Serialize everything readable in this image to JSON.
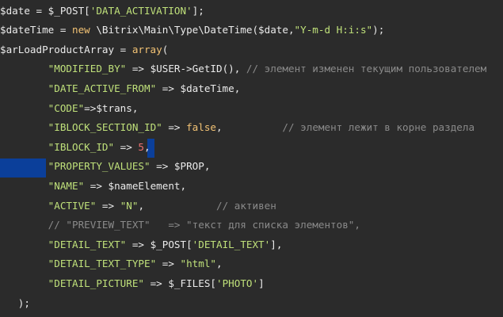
{
  "editor": {
    "colors": {
      "background": "#2b2b2b",
      "selection": "#0b3f9a",
      "string": "#bfe07a",
      "keyword": "#f2c274",
      "number": "#f27272",
      "comment": "#8a8a8a"
    },
    "lines": [
      {
        "tokens": [
          {
            "t": "$date = $_POST[",
            "c": "var"
          },
          {
            "t": "'DATA_ACTIVATION'",
            "c": "str"
          },
          {
            "t": "];",
            "c": "op"
          }
        ]
      },
      {
        "tokens": [
          {
            "t": "$dateTime = ",
            "c": "var"
          },
          {
            "t": "new",
            "c": "kw"
          },
          {
            "t": " \\Bitrix\\Main\\Type\\DateTime($date,",
            "c": "plain"
          },
          {
            "t": "\"Y-m-d H:i:s\"",
            "c": "str"
          },
          {
            "t": ");",
            "c": "op"
          }
        ]
      },
      {
        "tokens": [
          {
            "t": "$arLoadProductArray = ",
            "c": "var"
          },
          {
            "t": "array",
            "c": "kw"
          },
          {
            "t": "(",
            "c": "op"
          }
        ]
      },
      {
        "tokens": [
          {
            "t": "        ",
            "c": "plain"
          },
          {
            "t": "\"MODIFIED_BY\"",
            "c": "str"
          },
          {
            "t": " => $USER->GetID(), ",
            "c": "plain"
          },
          {
            "t": "// элемент изменен текущим пользователем",
            "c": "cm"
          }
        ]
      },
      {
        "tokens": [
          {
            "t": "        ",
            "c": "plain"
          },
          {
            "t": "\"DATE_ACTIVE_FROM\"",
            "c": "str"
          },
          {
            "t": " => $dateTime,",
            "c": "plain"
          }
        ]
      },
      {
        "tokens": [
          {
            "t": "        ",
            "c": "plain"
          },
          {
            "t": "\"CODE\"",
            "c": "str"
          },
          {
            "t": "=>$trans,",
            "c": "plain"
          }
        ]
      },
      {
        "tokens": [
          {
            "t": "        ",
            "c": "plain"
          },
          {
            "t": "\"IBLOCK_SECTION_ID\"",
            "c": "str"
          },
          {
            "t": " => ",
            "c": "plain"
          },
          {
            "t": "false",
            "c": "kw"
          },
          {
            "t": ",          ",
            "c": "plain"
          },
          {
            "t": "// элемент лежит в корне раздела",
            "c": "cm"
          }
        ]
      },
      {
        "tokens": [
          {
            "t": "        ",
            "c": "plain"
          },
          {
            "t": "\"IBLOCK_ID\"",
            "c": "str"
          },
          {
            "t": " => ",
            "c": "plain"
          },
          {
            "t": "5",
            "c": "num"
          },
          {
            "t": ",",
            "c": "plain"
          }
        ]
      },
      {
        "tokens": [
          {
            "t": "        ",
            "c": "plain"
          },
          {
            "t": "\"PROPERTY_VALUES\"",
            "c": "str"
          },
          {
            "t": " => $PROP,",
            "c": "plain"
          }
        ]
      },
      {
        "tokens": [
          {
            "t": "        ",
            "c": "plain"
          },
          {
            "t": "\"NAME\"",
            "c": "str"
          },
          {
            "t": " => $nameElement,",
            "c": "plain"
          }
        ]
      },
      {
        "tokens": [
          {
            "t": "        ",
            "c": "plain"
          },
          {
            "t": "\"ACTIVE\"",
            "c": "str"
          },
          {
            "t": " => ",
            "c": "plain"
          },
          {
            "t": "\"N\"",
            "c": "str"
          },
          {
            "t": ",            ",
            "c": "plain"
          },
          {
            "t": "// активен",
            "c": "cm"
          }
        ]
      },
      {
        "tokens": [
          {
            "t": "        ",
            "c": "plain"
          },
          {
            "t": "// \"PREVIEW_TEXT\"   => \"текст для списка элементов\",",
            "c": "cm"
          }
        ]
      },
      {
        "tokens": [
          {
            "t": "        ",
            "c": "plain"
          },
          {
            "t": "\"DETAIL_TEXT\"",
            "c": "str"
          },
          {
            "t": " => $_POST[",
            "c": "plain"
          },
          {
            "t": "'DETAIL_TEXT'",
            "c": "str"
          },
          {
            "t": "],",
            "c": "plain"
          }
        ]
      },
      {
        "tokens": [
          {
            "t": "        ",
            "c": "plain"
          },
          {
            "t": "\"DETAIL_TEXT_TYPE\"",
            "c": "str"
          },
          {
            "t": " => ",
            "c": "plain"
          },
          {
            "t": "\"html\"",
            "c": "str"
          },
          {
            "t": ",",
            "c": "plain"
          }
        ]
      },
      {
        "tokens": [
          {
            "t": "        ",
            "c": "plain"
          },
          {
            "t": "\"DETAIL_PICTURE\"",
            "c": "str"
          },
          {
            "t": " => $_FILES[",
            "c": "plain"
          },
          {
            "t": "'PHOTO'",
            "c": "str"
          },
          {
            "t": "]",
            "c": "plain"
          }
        ]
      },
      {
        "tokens": [
          {
            "t": "   );",
            "c": "plain"
          }
        ]
      }
    ]
  }
}
